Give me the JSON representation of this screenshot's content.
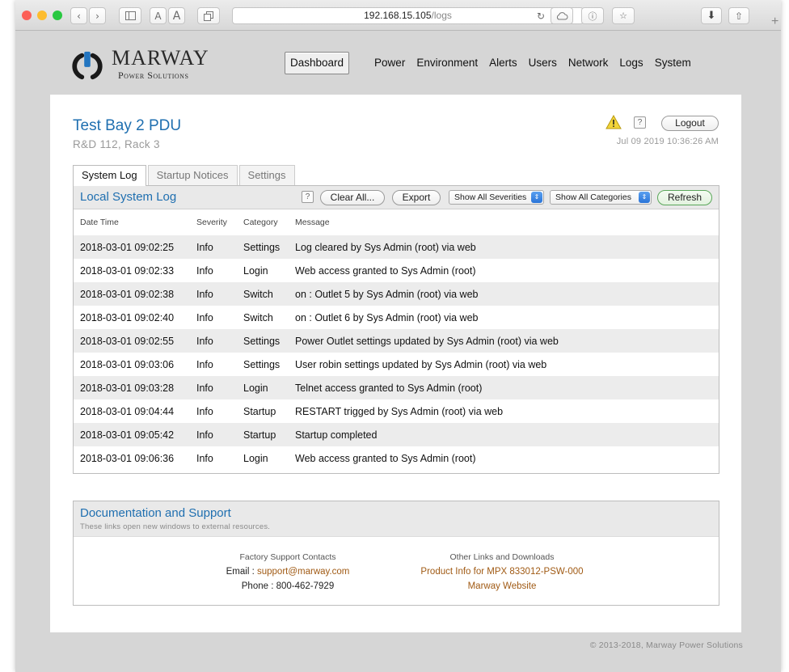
{
  "browser": {
    "url_host": "192.168.15.105",
    "url_path": "/logs",
    "text_size_small": "A",
    "text_size_large": "A"
  },
  "brand": {
    "name": "MARWAY",
    "tagline": "Power Solutions"
  },
  "nav": {
    "items": [
      {
        "label": "Dashboard"
      },
      {
        "label": "Power"
      },
      {
        "label": "Environment"
      },
      {
        "label": "Alerts"
      },
      {
        "label": "Users"
      },
      {
        "label": "Network"
      },
      {
        "label": "Logs"
      },
      {
        "label": "System"
      }
    ]
  },
  "device": {
    "title": "Test Bay 2 PDU",
    "location": "R&D 112, Rack 3",
    "help_label": "?",
    "logout_label": "Logout",
    "timestamp": "Jul 09 2019 10:36:26 AM"
  },
  "tabs": [
    {
      "label": "System Log"
    },
    {
      "label": "Startup Notices"
    },
    {
      "label": "Settings"
    }
  ],
  "log": {
    "title": "Local System Log",
    "help_label": "?",
    "clear_label": "Clear All...",
    "export_label": "Export",
    "severity_filter": "Show All Severities",
    "category_filter": "Show All Categories",
    "refresh_label": "Refresh",
    "columns": [
      "Date Time",
      "Severity",
      "Category",
      "Message"
    ],
    "rows": [
      {
        "datetime": "2018-03-01 09:02:25",
        "severity": "Info",
        "category": "Settings",
        "message": "Log cleared by Sys Admin (root) via web"
      },
      {
        "datetime": "2018-03-01 09:02:33",
        "severity": "Info",
        "category": "Login",
        "message": "Web access granted to Sys Admin (root)"
      },
      {
        "datetime": "2018-03-01 09:02:38",
        "severity": "Info",
        "category": "Switch",
        "message": "on : Outlet 5 by Sys Admin (root) via web"
      },
      {
        "datetime": "2018-03-01 09:02:40",
        "severity": "Info",
        "category": "Switch",
        "message": "on : Outlet 6 by Sys Admin (root) via web"
      },
      {
        "datetime": "2018-03-01 09:02:55",
        "severity": "Info",
        "category": "Settings",
        "message": "Power Outlet settings updated by Sys Admin (root) via web"
      },
      {
        "datetime": "2018-03-01 09:03:06",
        "severity": "Info",
        "category": "Settings",
        "message": "User robin settings updated by Sys Admin (root) via web"
      },
      {
        "datetime": "2018-03-01 09:03:28",
        "severity": "Info",
        "category": "Login",
        "message": "Telnet access granted to Sys Admin (root)"
      },
      {
        "datetime": "2018-03-01 09:04:44",
        "severity": "Info",
        "category": "Startup",
        "message": "RESTART trigged by Sys Admin (root) via web"
      },
      {
        "datetime": "2018-03-01 09:05:42",
        "severity": "Info",
        "category": "Startup",
        "message": "Startup completed"
      },
      {
        "datetime": "2018-03-01 09:06:36",
        "severity": "Info",
        "category": "Login",
        "message": "Web access granted to Sys Admin (root)"
      }
    ]
  },
  "docs": {
    "title": "Documentation and Support",
    "subtitle": "These links open new windows to external resources.",
    "support_heading": "Factory Support Contacts",
    "email_label": "Email : ",
    "email": "support@marway.com",
    "phone": "Phone : 800-462-7929",
    "links_heading": "Other Links and Downloads",
    "product_link": "Product Info for MPX 833012-PSW-000",
    "website_link": "Marway Website"
  },
  "footer": {
    "copyright": "© 2013-2018, Marway Power Solutions"
  },
  "colors": {
    "accent": "#1f6fb0",
    "link": "#a05a14",
    "warning": "#f2d43a"
  }
}
